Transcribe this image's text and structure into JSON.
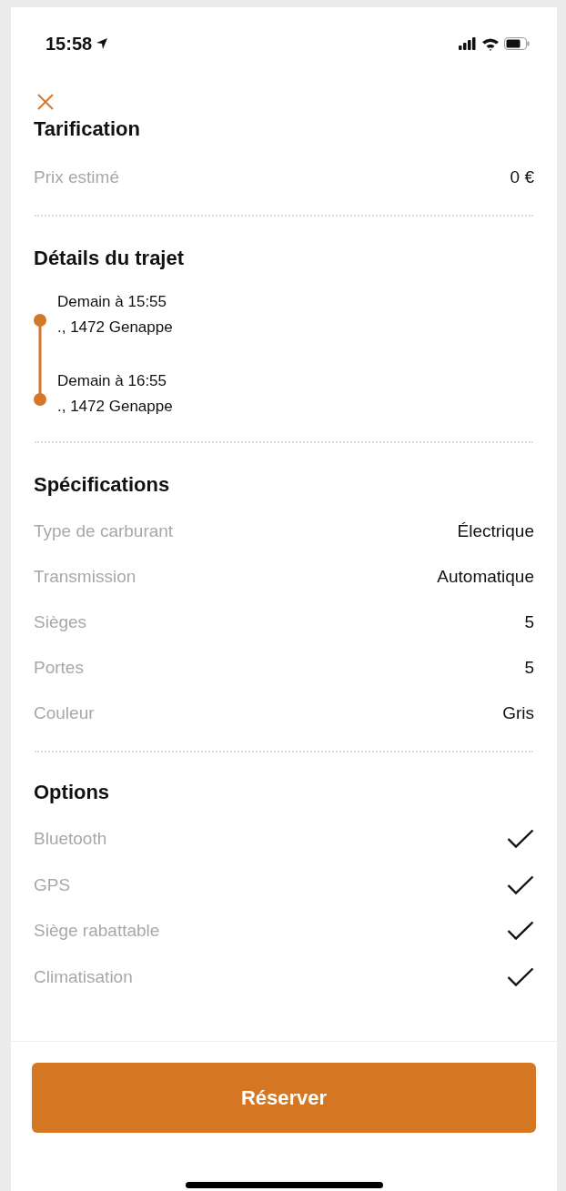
{
  "status_bar": {
    "time": "15:58"
  },
  "pricing": {
    "title": "Tarification",
    "rows": [
      {
        "label": "Prix estimé",
        "value": "0 €"
      }
    ]
  },
  "trip": {
    "title": "Détails du trajet",
    "stops": [
      {
        "time": "Demain à 15:55",
        "address": "., 1472 Genappe"
      },
      {
        "time": "Demain à 16:55",
        "address": "., 1472 Genappe"
      }
    ]
  },
  "specifications": {
    "title": "Spécifications",
    "rows": [
      {
        "label": "Type de carburant",
        "value": "Électrique"
      },
      {
        "label": "Transmission",
        "value": "Automatique"
      },
      {
        "label": "Sièges",
        "value": "5"
      },
      {
        "label": "Portes",
        "value": "5"
      },
      {
        "label": "Couleur",
        "value": "Gris"
      }
    ]
  },
  "options": {
    "title": "Options",
    "items": [
      {
        "label": "Bluetooth",
        "checked": true
      },
      {
        "label": "GPS",
        "checked": true
      },
      {
        "label": "Siège rabattable",
        "checked": true
      },
      {
        "label": "Climatisation",
        "checked": true
      }
    ]
  },
  "primary_button": "Réserver"
}
